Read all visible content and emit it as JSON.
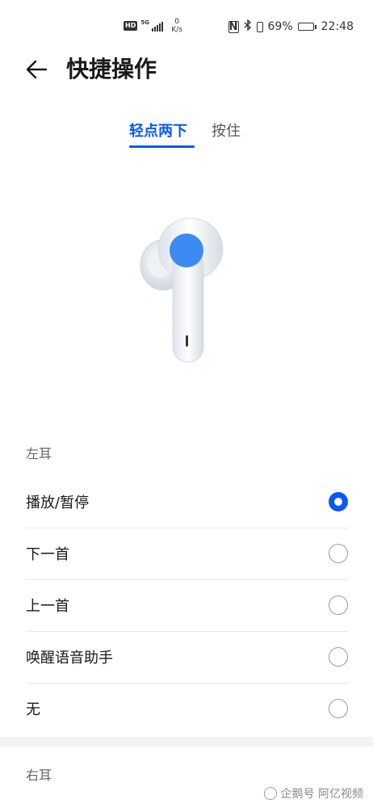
{
  "status_bar": {
    "hd_label": "HD",
    "network_label": "5G",
    "speed_value": "0",
    "speed_unit": "K/s",
    "nfc_label": "N",
    "battery_percent": "69%",
    "battery_level": 0.69,
    "time": "22:48"
  },
  "header": {
    "title": "快捷操作"
  },
  "tabs": [
    {
      "label": "轻点两下",
      "active": true
    },
    {
      "label": "按住",
      "active": false
    }
  ],
  "left_ear": {
    "label": "左耳",
    "options": [
      {
        "label": "播放/暂停",
        "selected": true
      },
      {
        "label": "下一首",
        "selected": false
      },
      {
        "label": "上一首",
        "selected": false
      },
      {
        "label": "唤醒语音助手",
        "selected": false
      },
      {
        "label": "无",
        "selected": false
      }
    ]
  },
  "right_ear": {
    "label": "右耳"
  },
  "watermark": {
    "text": "企鹅号 阿亿视频"
  },
  "colors": {
    "accent": "#0a59f7",
    "earbud_dot": "#3d8bf2"
  }
}
